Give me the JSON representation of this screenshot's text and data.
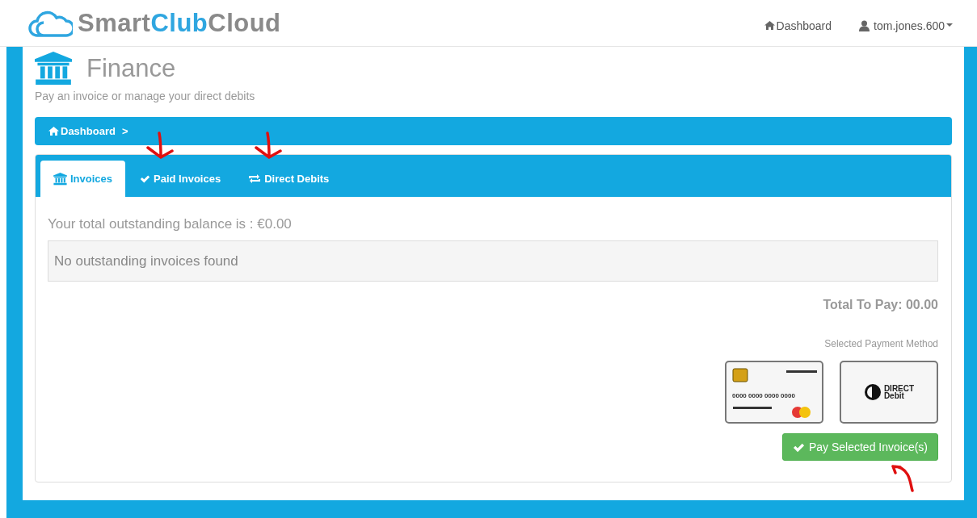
{
  "brand": {
    "part_1": "Smart",
    "part_2": "Club",
    "part_3": "Cloud"
  },
  "nav": {
    "dashboard": "Dashboard",
    "user": "tom.jones.600"
  },
  "page": {
    "title": "Finance",
    "subtitle": "Pay an invoice or manage your direct debits"
  },
  "breadcrumb": {
    "items": [
      "Dashboard"
    ],
    "separator": ">"
  },
  "tabs": [
    {
      "label": "Invoices",
      "kind": "bank",
      "selected": true,
      "annotated": false
    },
    {
      "label": "Paid Invoices",
      "kind": "check",
      "selected": false,
      "annotated": true
    },
    {
      "label": "Direct Debits",
      "kind": "repeat",
      "selected": false,
      "annotated": true
    }
  ],
  "balance": "Your total outstanding balance is : €0.00",
  "empty_message": "No outstanding invoices found",
  "total": "Total To Pay: 00.00",
  "payment": {
    "label": "Selected Payment Method",
    "methods": [
      {
        "kind": "card",
        "number": "0000 0000 0000 0000"
      },
      {
        "kind": "direct_debit",
        "line_1": "DIRECT",
        "line_2": "Debit"
      }
    ]
  },
  "pay_button": {
    "label": "Pay Selected Invoice(s)",
    "annotated": true
  }
}
